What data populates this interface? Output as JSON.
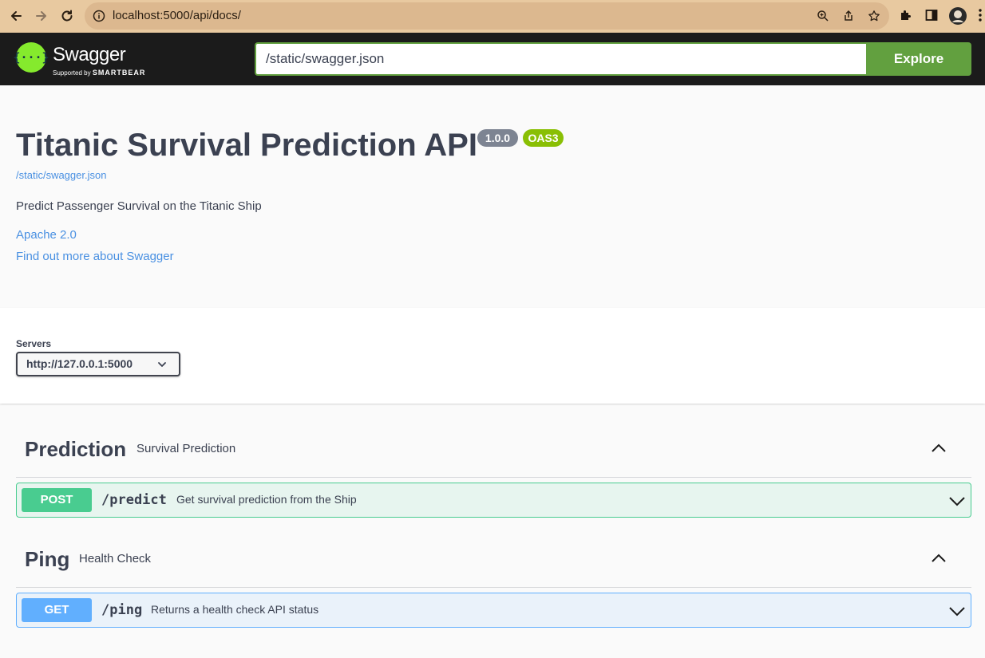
{
  "browser": {
    "url": "localhost:5000/api/docs/",
    "icons": [
      "back-icon",
      "forward-icon",
      "reload-icon",
      "info-icon",
      "zoom-icon",
      "share-icon",
      "star-icon",
      "puzzle-icon",
      "sidepanel-icon",
      "profile-icon",
      "menu-icon"
    ]
  },
  "topbar": {
    "logo_text": "Swagger",
    "logo_sub_prefix": "Supported by",
    "logo_sub_brand": "SMARTBEAR",
    "spec_url": "/static/swagger.json",
    "explore_label": "Explore"
  },
  "info": {
    "title": "Titanic Survival Prediction API",
    "version": "1.0.0",
    "oas": "OAS3",
    "spec_link": "/static/swagger.json",
    "description": "Predict Passenger Survival on the Titanic Ship",
    "license": "Apache 2.0",
    "external_docs": "Find out more about Swagger"
  },
  "servers": {
    "label": "Servers",
    "selected": "http://127.0.0.1:5000"
  },
  "tags": [
    {
      "name": "Prediction",
      "description": "Survival Prediction",
      "operations": [
        {
          "method": "POST",
          "path": "/predict",
          "summary": "Get survival prediction from the Ship"
        }
      ]
    },
    {
      "name": "Ping",
      "description": "Health Check",
      "operations": [
        {
          "method": "GET",
          "path": "/ping",
          "summary": "Returns a health check API status"
        }
      ]
    }
  ],
  "colors": {
    "post": "#49cc90",
    "get": "#61affe",
    "swagger_green": "#62a03f",
    "topbar": "#1b1b1b"
  }
}
